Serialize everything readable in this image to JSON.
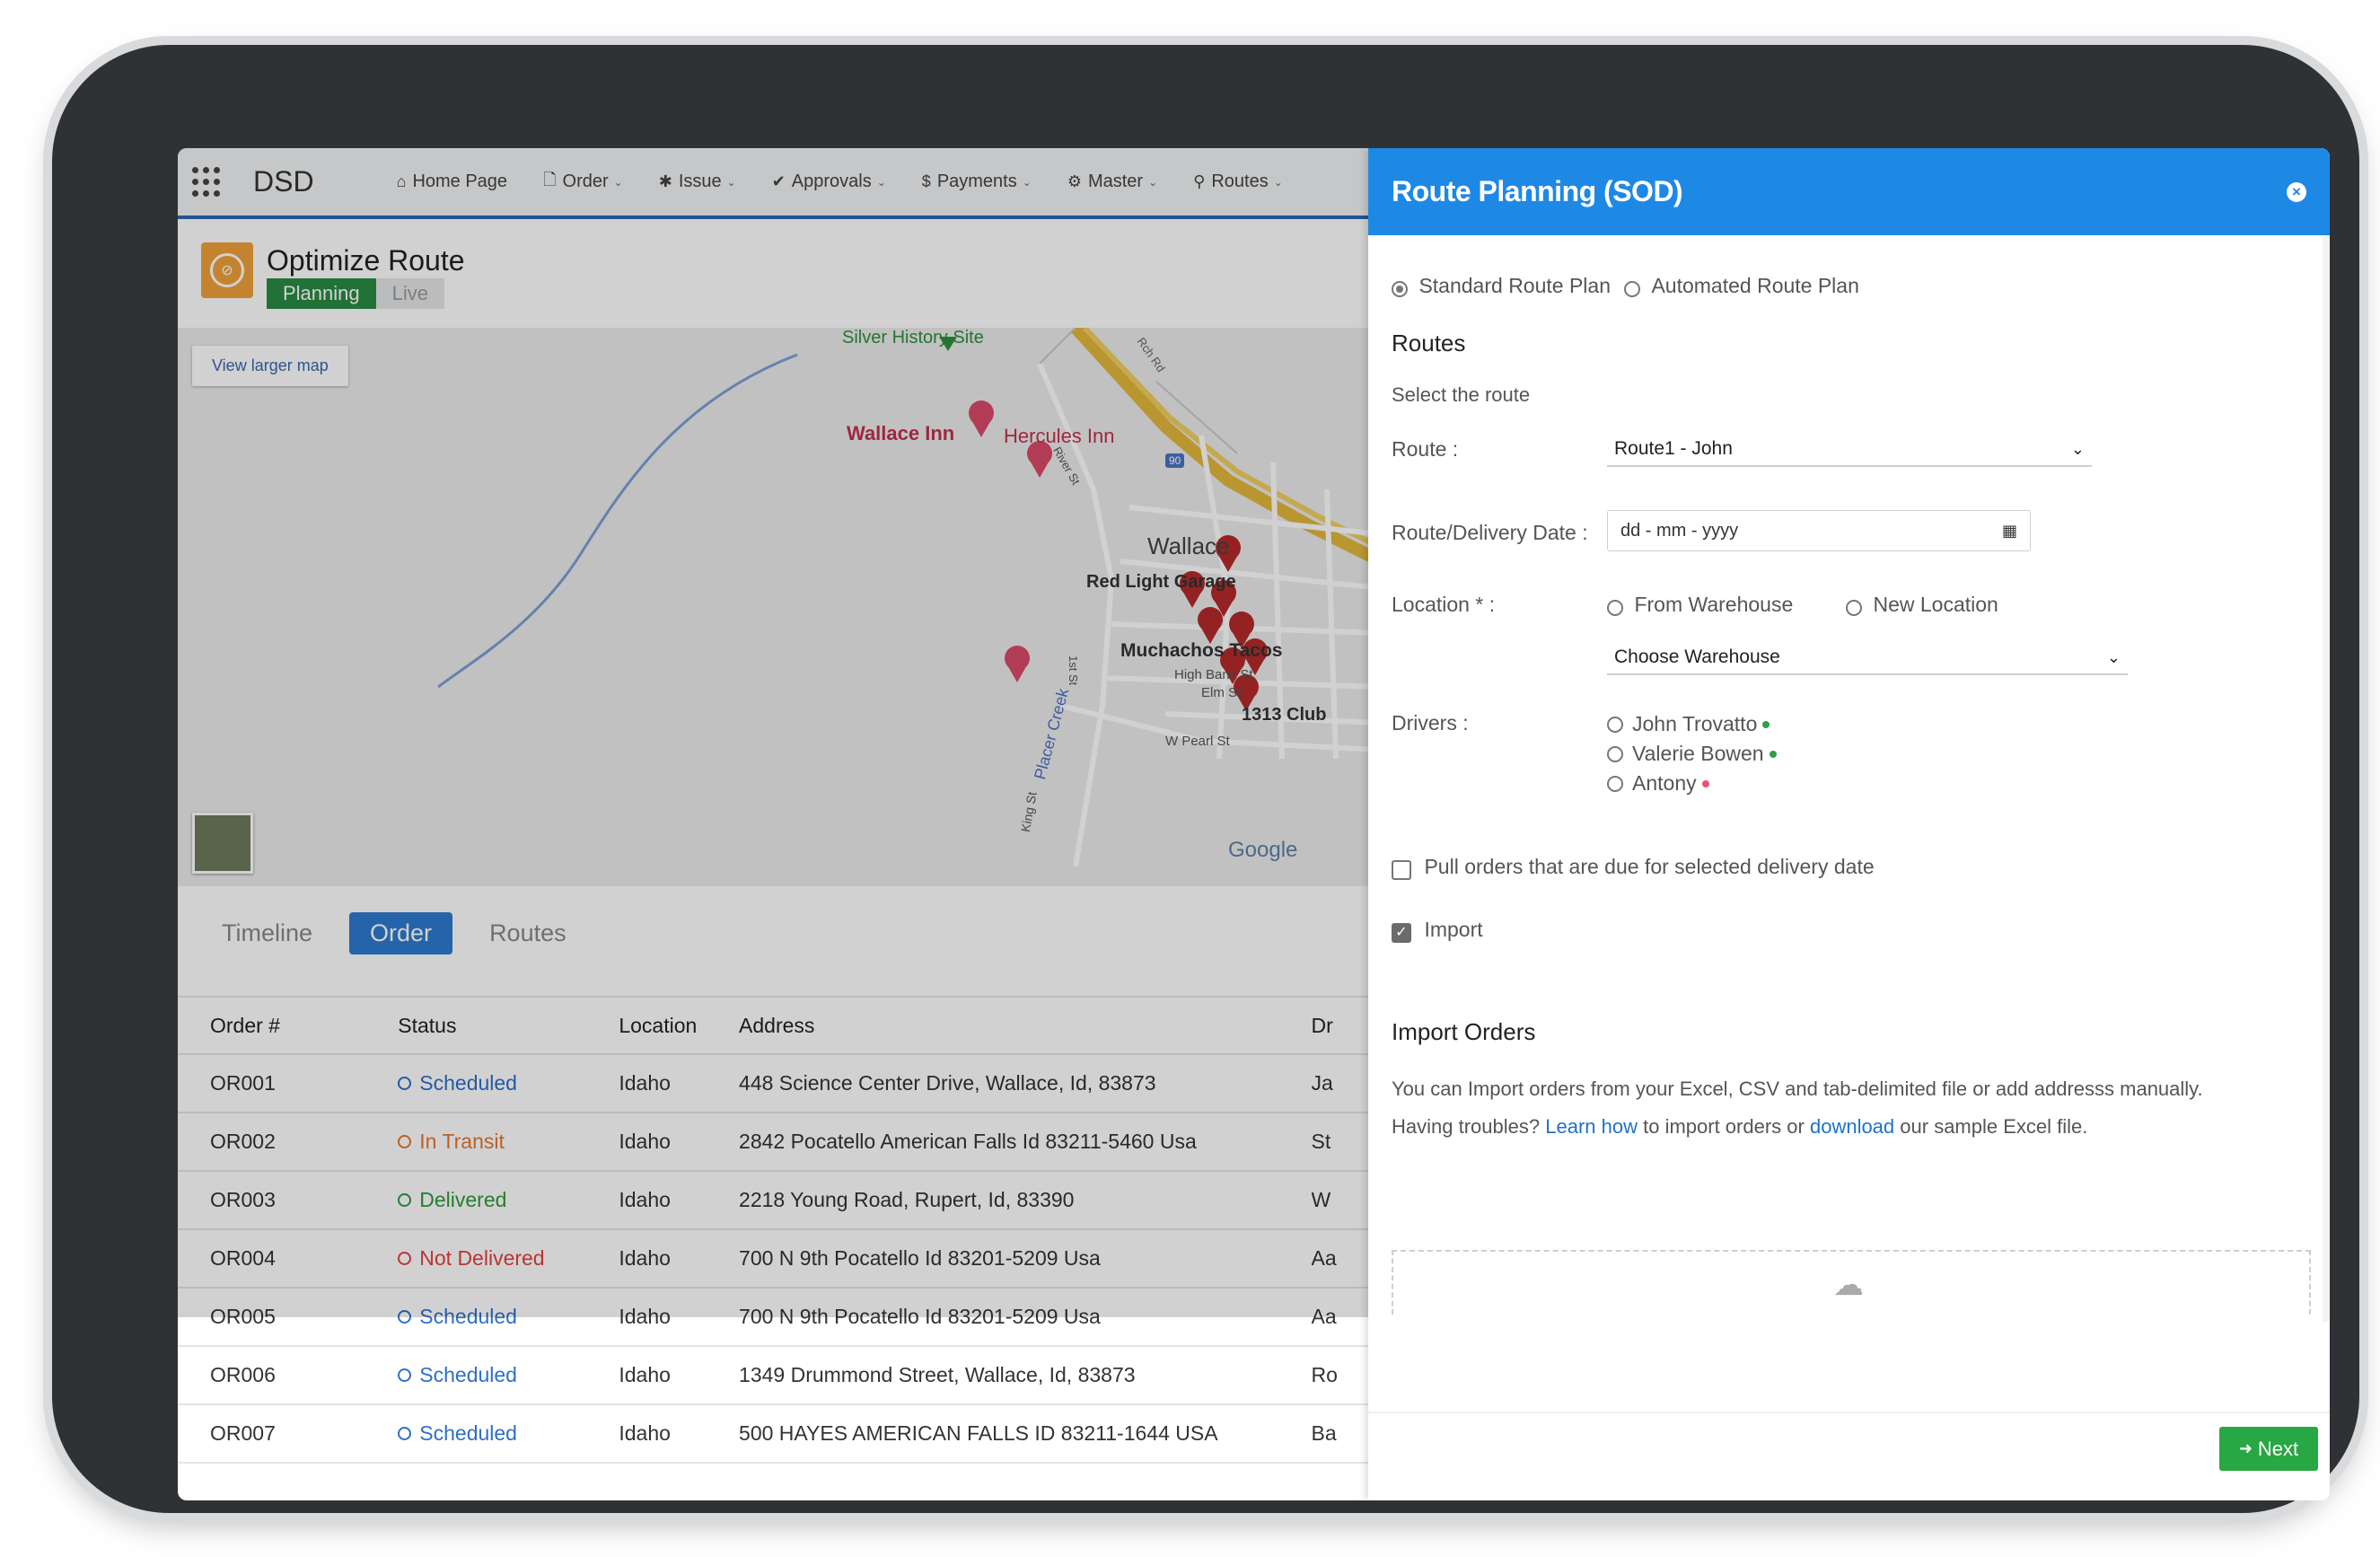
{
  "app": {
    "brand": "DSD"
  },
  "nav": {
    "items": [
      {
        "label": "Home Page",
        "icon": "home-icon",
        "glyph": "⌂",
        "has_caret": false
      },
      {
        "label": "Order",
        "icon": "document-icon",
        "glyph": "🗋",
        "has_caret": true
      },
      {
        "label": "Issue",
        "icon": "bug-icon",
        "glyph": "✱",
        "has_caret": true
      },
      {
        "label": "Approvals",
        "icon": "check-icon",
        "glyph": "✔",
        "has_caret": true
      },
      {
        "label": "Payments",
        "icon": "dollar-icon",
        "glyph": "$",
        "has_caret": true
      },
      {
        "label": "Master",
        "icon": "gear-icon",
        "glyph": "⚙",
        "has_caret": true
      },
      {
        "label": "Routes",
        "icon": "map-marker-icon",
        "glyph": "⚲",
        "has_caret": true
      }
    ]
  },
  "page": {
    "title": "Optimize Route",
    "mode_tabs": {
      "active": "Planning",
      "inactive": "Live"
    }
  },
  "map": {
    "view_larger": "View larger map",
    "labels": {
      "silver_history": "Silver History Site",
      "wallace_inn": "Wallace Inn",
      "hercules_inn": "Hercules Inn",
      "wallace": "Wallace",
      "red_light": "Red Light Garage",
      "muchachos": "Muchachos Tacos",
      "high_bank": "High Bank St",
      "elm": "Elm St",
      "club": "1313 Club",
      "w_pearl": "W Pearl St",
      "placer_creek": "Placer Creek",
      "king_st": "King St",
      "first_st": "1st St",
      "river_st": "River St",
      "ninety": "90",
      "ranch_rd": "Rch Rd"
    },
    "google": "Google"
  },
  "subtabs": {
    "items": [
      "Timeline",
      "Order",
      "Routes"
    ],
    "active": "Order"
  },
  "orders": {
    "headers": [
      "Order #",
      "Status",
      "Location",
      "Address",
      "Dr"
    ],
    "rows": [
      {
        "id": "OR001",
        "status": "Scheduled",
        "status_type": "scheduled",
        "location": "Idaho",
        "address": "448 Science Center Drive, Wallace, Id, 83873",
        "driver": "Ja"
      },
      {
        "id": "OR002",
        "status": "In Transit",
        "status_type": "transit",
        "location": "Idaho",
        "address": "2842 Pocatello American Falls Id 83211-5460 Usa",
        "driver": "St"
      },
      {
        "id": "OR003",
        "status": "Delivered",
        "status_type": "delivered",
        "location": "Idaho",
        "address": "2218 Young Road, Rupert, Id, 83390",
        "driver": "W"
      },
      {
        "id": "OR004",
        "status": "Not Delivered",
        "status_type": "notdelivered",
        "location": "Idaho",
        "address": "700 N 9th Pocatello Id 83201-5209 Usa",
        "driver": "Aa"
      },
      {
        "id": "OR005",
        "status": "Scheduled",
        "status_type": "scheduled",
        "location": "Idaho",
        "address": "700 N 9th Pocatello Id 83201-5209 Usa",
        "driver": "Aa"
      },
      {
        "id": "OR006",
        "status": "Scheduled",
        "status_type": "scheduled",
        "location": "Idaho",
        "address": "1349 Drummond Street, Wallace, Id, 83873",
        "driver": "Ro"
      },
      {
        "id": "OR007",
        "status": "Scheduled",
        "status_type": "scheduled",
        "location": "Idaho",
        "address": "500 HAYES AMERICAN FALLS ID 83211-1644 USA",
        "driver": "Ba"
      }
    ],
    "dimmed_row_count": 5
  },
  "panel": {
    "title": "Route Planning (SOD)",
    "plan_types": [
      {
        "label": "Standard Route Plan",
        "checked": true
      },
      {
        "label": "Automated Route Plan",
        "checked": false
      }
    ],
    "routes_heading": "Routes",
    "select_route_hint": "Select the route",
    "route_label": "Route :",
    "route_value": "Route1 - John",
    "date_label": "Route/Delivery Date :",
    "date_placeholder": "dd - mm - yyyy",
    "location_label": "Location * :",
    "location_options": [
      {
        "label": "From Warehouse",
        "checked": false
      },
      {
        "label": "New Location",
        "checked": false
      }
    ],
    "warehouse_value": "Choose Warehouse",
    "drivers_label": "Drivers :",
    "drivers": [
      {
        "name": "John Trovatto",
        "status_color": "#2ea043"
      },
      {
        "name": "Valerie Bowen",
        "status_color": "#2ea043"
      },
      {
        "name": "Antony",
        "status_color": "#f0506e"
      }
    ],
    "pull_orders": {
      "label": "Pull orders that are due for selected delivery date",
      "checked": false
    },
    "import_check": {
      "label": "Import",
      "checked": true
    },
    "import_heading": "Import Orders",
    "import_desc": "You can Import orders from your Excel, CSV and tab-delimited file or add addresss manually.",
    "help_prefix": "Having troubles?",
    "help_link1": "Learn how",
    "help_mid": "to import orders or",
    "help_link2": "download",
    "help_suffix": "our sample Excel file.",
    "next_label": "Next"
  }
}
